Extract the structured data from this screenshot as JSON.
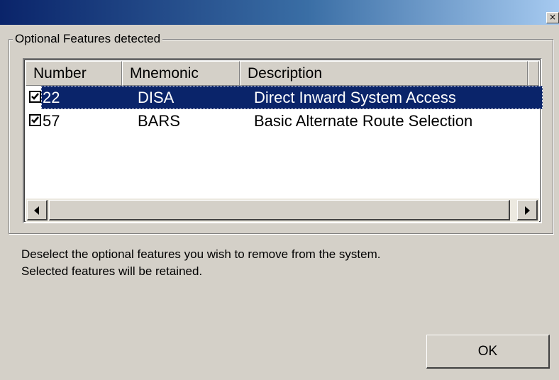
{
  "window": {
    "close_glyph": "×"
  },
  "group": {
    "label": "Optional Features detected"
  },
  "list": {
    "columns": [
      "Number",
      "Mnemonic",
      "Description"
    ],
    "rows": [
      {
        "checked": true,
        "number": "22",
        "mnemonic": "DISA",
        "description": "Direct Inward System Access",
        "selected": true
      },
      {
        "checked": true,
        "number": "57",
        "mnemonic": "BARS",
        "description": "Basic Alternate Route Selection",
        "selected": false
      }
    ]
  },
  "instructions": {
    "line1": "Deselect the optional features you wish to remove from the system.",
    "line2": "Selected features will be retained."
  },
  "buttons": {
    "ok_label": "OK"
  },
  "colors": {
    "titlebar_start": "#0a246a",
    "selection": "#0a246a",
    "face": "#d4d0c8"
  }
}
